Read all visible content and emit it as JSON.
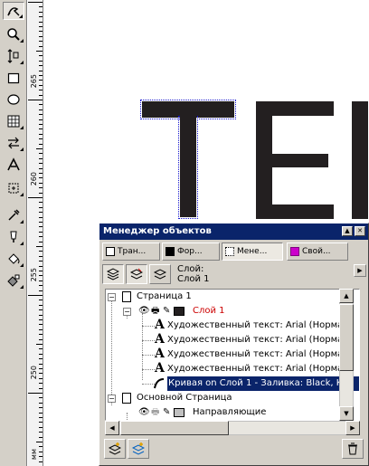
{
  "toolbox": {
    "tools": [
      {
        "name": "pick-tool",
        "glyph": "↖"
      },
      {
        "name": "zoom-tool",
        "glyph": "🔍"
      },
      {
        "name": "freehand-tool",
        "glyph": "↕"
      },
      {
        "name": "rectangle-tool",
        "glyph": "□"
      },
      {
        "name": "ellipse-tool",
        "glyph": "○"
      },
      {
        "name": "graph-paper-tool",
        "glyph": "▦"
      },
      {
        "name": "connector-tool",
        "glyph": "⇆"
      },
      {
        "name": "text-tool",
        "glyph": "A"
      },
      {
        "name": "interactive-tool",
        "glyph": "⊡"
      },
      {
        "name": "eyedropper-tool",
        "glyph": "✎"
      },
      {
        "name": "outline-tool",
        "glyph": "✒"
      },
      {
        "name": "fill-tool",
        "glyph": "◈"
      },
      {
        "name": "interactive-fill-tool",
        "glyph": "◆"
      }
    ]
  },
  "ruler": {
    "labels": [
      "265",
      "260",
      "255",
      "250",
      "мм"
    ]
  },
  "canvas": {
    "letters": [
      "E"
    ]
  },
  "object_manager": {
    "title": "Менеджер объектов",
    "tabs": [
      "Тран...",
      "Фор...",
      "Мене...",
      "Свой..."
    ],
    "layer_label": "Слой:",
    "layer_value": "Слой 1",
    "tree": {
      "page1": "Страница 1",
      "layer1": "Слой 1",
      "items": [
        "Художественный текст: Arial (Норма",
        "Художественный текст: Arial (Норма",
        "Художественный текст: Arial (Норма",
        "Художественный текст: Arial (Норма"
      ],
      "curve": "Кривая on Слой 1  - Заливка: Black, К",
      "master_page": "Основной Страница",
      "guides": "Направляющие"
    },
    "colors": {
      "title_bar": "#0a246a",
      "layer1_text": "#cc0000",
      "swatch_layer1": "#231f20",
      "swatch_guides": "#c0c0c0"
    }
  }
}
